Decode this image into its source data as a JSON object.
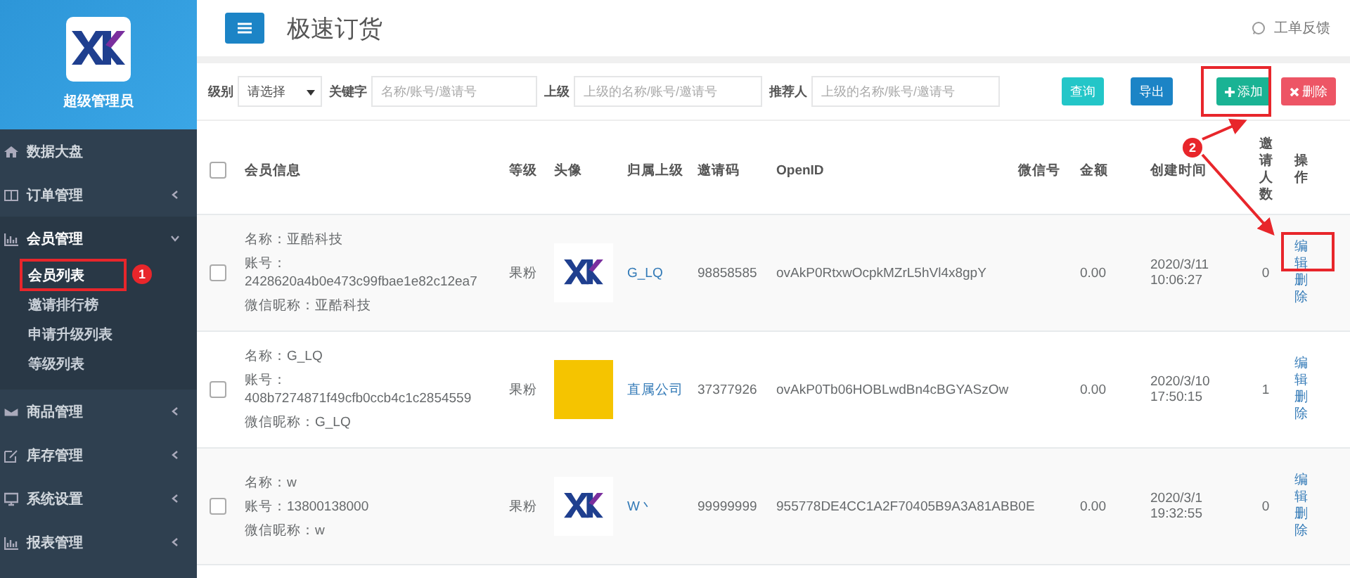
{
  "sidebar": {
    "user_role": "超级管理员",
    "items": [
      {
        "label": "数据大盘",
        "expandable": false,
        "expanded": false,
        "selected": false
      },
      {
        "label": "订单管理",
        "expandable": true,
        "expanded": false,
        "selected": false
      },
      {
        "label": "会员管理",
        "expandable": true,
        "expanded": true,
        "selected": false,
        "children": [
          {
            "label": "会员列表",
            "selected": true
          },
          {
            "label": "邀请排行榜",
            "selected": false
          },
          {
            "label": "申请升级列表",
            "selected": false
          },
          {
            "label": "等级列表",
            "selected": false
          }
        ]
      },
      {
        "label": "商品管理",
        "expandable": true,
        "expanded": false,
        "selected": false
      },
      {
        "label": "库存管理",
        "expandable": true,
        "expanded": false,
        "selected": false
      },
      {
        "label": "系统设置",
        "expandable": true,
        "expanded": false,
        "selected": false
      },
      {
        "label": "报表管理",
        "expandable": true,
        "expanded": false,
        "selected": false
      }
    ]
  },
  "header": {
    "title": "极速订货",
    "feedback": "工单反馈"
  },
  "filters": {
    "level_label": "级别",
    "level_value": "请选择",
    "keyword_label": "关键字",
    "keyword_placeholder": "名称/账号/邀请号",
    "parent_label": "上级",
    "parent_placeholder": "上级的名称/账号/邀请号",
    "referrer_label": "推荐人",
    "referrer_placeholder": "上级的名称/账号/邀请号",
    "buttons": [
      {
        "label": "查询",
        "kind": "query"
      },
      {
        "label": "导出",
        "kind": "export"
      },
      {
        "label": "添加",
        "kind": "add"
      },
      {
        "label": "删除",
        "kind": "delete"
      }
    ]
  },
  "table": {
    "select_all_checked": false,
    "columns": [
      "会员信息",
      "等级",
      "头像",
      "归属上级",
      "邀请码",
      "OpenID",
      "微信号",
      "金额",
      "创建时间",
      "邀请人数",
      "操作"
    ],
    "rows": [
      {
        "checked": false,
        "name": "名称：亚酷科技",
        "account": "账号：2428620a4b0e473c99fbae1e82c12ea7",
        "nickname": "微信昵称：亚酷科技",
        "level": "果粉",
        "avatar": {
          "kind": "logo"
        },
        "parent": "G_LQ",
        "invite_code": "98858585",
        "openid": "ovAkP0RtxwOcpkMZrL5hVl4x8gpY",
        "amount": "0.00",
        "created": [
          "2020/3/11",
          "10:06:27"
        ],
        "invites": "0",
        "actions": [
          "编辑",
          "删除"
        ]
      },
      {
        "checked": false,
        "name": "名称：G_LQ",
        "account": "账号：408b7274871f49cfb0ccb4c1c2854559",
        "nickname": "微信昵称：G_LQ",
        "level": "果粉",
        "avatar": {
          "kind": "photo"
        },
        "parent": "直属公司",
        "invite_code": "37377926",
        "openid": "ovAkP0Tb06HOBLwdBn4cBGYASzOw",
        "amount": "0.00",
        "created": [
          "2020/3/10",
          "17:50:15"
        ],
        "invites": "1",
        "actions": [
          "编辑",
          "删除"
        ]
      },
      {
        "checked": false,
        "name": "名称：w",
        "account": "账号：13800138000",
        "nickname": "微信昵称：w",
        "level": "果粉",
        "avatar": {
          "kind": "logo"
        },
        "parent": "W丶",
        "invite_code": "99999999",
        "openid": "955778DE4CC1A2F70405B9A3A81ABB0E",
        "amount": "0.00",
        "created": [
          "2020/3/1",
          "19:32:55"
        ],
        "invites": "0",
        "actions": [
          "编辑",
          "删除"
        ]
      }
    ]
  },
  "annotations": [
    {
      "label": "1"
    },
    {
      "label": "2"
    }
  ]
}
